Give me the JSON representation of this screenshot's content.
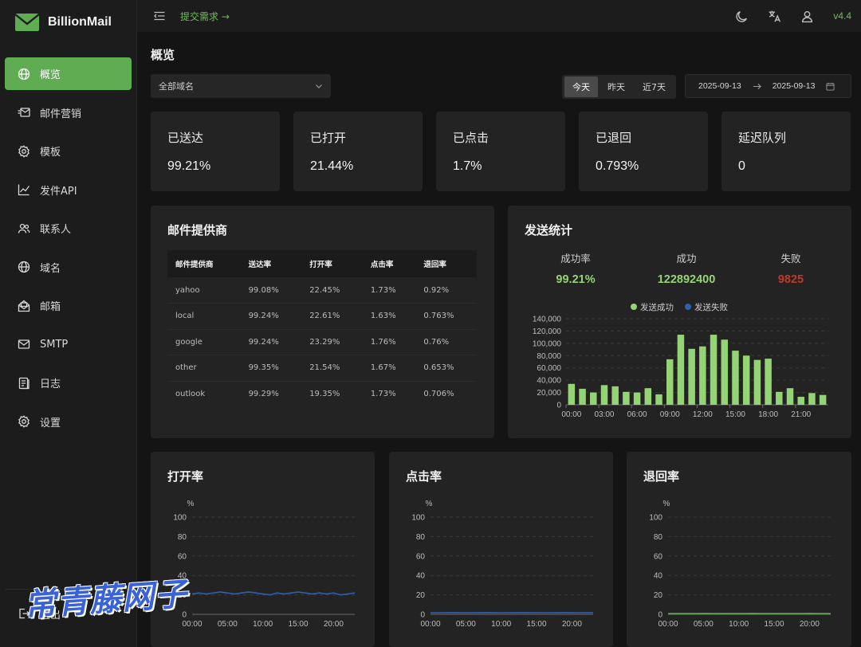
{
  "app": {
    "name": "BillionMail",
    "version": "v4.4"
  },
  "topbar": {
    "submit_link": "提交需求 →"
  },
  "sidebar": {
    "items": [
      {
        "label": "概览",
        "icon": "globe-icon",
        "active": true
      },
      {
        "label": "邮件营销",
        "icon": "mail-marketing-icon",
        "active": false
      },
      {
        "label": "模板",
        "icon": "gear-icon",
        "active": false
      },
      {
        "label": "发件API",
        "icon": "chart-line-icon",
        "active": false
      },
      {
        "label": "联系人",
        "icon": "contacts-icon",
        "active": false
      },
      {
        "label": "域名",
        "icon": "globe-icon",
        "active": false
      },
      {
        "label": "邮箱",
        "icon": "mailbox-icon",
        "active": false
      },
      {
        "label": "SMTP",
        "icon": "mail-icon",
        "active": false
      },
      {
        "label": "日志",
        "icon": "log-icon",
        "active": false
      },
      {
        "label": "设置",
        "icon": "gear-icon",
        "active": false
      }
    ],
    "logout_label": "退出"
  },
  "page": {
    "title": "概览"
  },
  "filters": {
    "domain_select": "全部域名",
    "range_tabs": [
      "今天",
      "昨天",
      "近7天"
    ],
    "active_tab": "今天",
    "date_start": "2025-09-13",
    "date_end": "2025-09-13"
  },
  "stats": [
    {
      "label": "已送达",
      "value": "99.21%"
    },
    {
      "label": "已打开",
      "value": "21.44%"
    },
    {
      "label": "已点击",
      "value": "1.7%"
    },
    {
      "label": "已退回",
      "value": "0.793%"
    },
    {
      "label": "延迟队列",
      "value": "0"
    }
  ],
  "providers": {
    "title": "邮件提供商",
    "columns": [
      "邮件提供商",
      "送达率",
      "打开率",
      "点击率",
      "退回率"
    ],
    "rows": [
      [
        "yahoo",
        "99.08%",
        "22.45%",
        "1.73%",
        "0.92%"
      ],
      [
        "local",
        "99.24%",
        "22.61%",
        "1.63%",
        "0.763%"
      ],
      [
        "google",
        "99.24%",
        "23.29%",
        "1.76%",
        "0.76%"
      ],
      [
        "other",
        "99.35%",
        "21.54%",
        "1.67%",
        "0.653%"
      ],
      [
        "outlook",
        "99.29%",
        "19.35%",
        "1.73%",
        "0.706%"
      ]
    ]
  },
  "send_stats": {
    "title": "发送统计",
    "success_rate_label": "成功率",
    "success_rate": "99.21%",
    "success_label": "成功",
    "success": "122892400",
    "fail_label": "失败",
    "fail": "9825"
  },
  "colors": {
    "accent": "#5fac52",
    "success_green": "#95d475",
    "fail_red": "#c0392b",
    "fail_series": "#2f5fb3"
  },
  "chart_data": [
    {
      "type": "bar",
      "legend": [
        "发送成功",
        "发送失败"
      ],
      "legend_position": "top",
      "x": [
        0,
        1,
        2,
        3,
        4,
        5,
        6,
        7,
        8,
        9,
        10,
        11,
        12,
        13,
        14,
        15,
        16,
        17,
        18,
        19,
        20,
        21,
        22,
        23
      ],
      "x_tick_labels": [
        "00:00",
        "03:00",
        "06:00",
        "09:00",
        "12:00",
        "15:00",
        "18:00",
        "21:00"
      ],
      "series": [
        {
          "name": "发送成功",
          "values": [
            34000,
            26000,
            20000,
            32000,
            30000,
            21000,
            20000,
            27000,
            17000,
            74000,
            114000,
            91000,
            95000,
            114000,
            106000,
            88000,
            80000,
            73000,
            75000,
            21000,
            27000,
            13000,
            19000,
            16000
          ]
        },
        {
          "name": "发送失败",
          "values": [
            0,
            0,
            0,
            0,
            0,
            0,
            0,
            0,
            0,
            0,
            0,
            0,
            0,
            0,
            0,
            0,
            0,
            0,
            0,
            0,
            0,
            0,
            0,
            0
          ]
        }
      ],
      "ylim": [
        0,
        140000
      ],
      "y_ticks": [
        "0",
        "20,000",
        "40,000",
        "60,000",
        "80,000",
        "100,000",
        "120,000",
        "140,000"
      ],
      "grid": true
    },
    {
      "type": "line",
      "title": "打开率",
      "ylabel": "%",
      "ylim": [
        0,
        100
      ],
      "y_ticks": [
        "0",
        "20",
        "40",
        "60",
        "80",
        "100"
      ],
      "x_tick_labels": [
        "00:00",
        "05:00",
        "10:00",
        "15:00",
        "20:00"
      ],
      "series": [
        {
          "values": [
            21,
            22,
            21,
            22,
            23,
            22,
            21,
            22,
            23,
            22,
            21,
            20,
            22,
            21,
            22,
            23,
            22,
            21,
            22,
            21,
            22,
            20,
            21,
            22
          ]
        }
      ],
      "grid": true
    },
    {
      "type": "line",
      "title": "点击率",
      "ylabel": "%",
      "ylim": [
        0,
        100
      ],
      "y_ticks": [
        "0",
        "20",
        "40",
        "60",
        "80",
        "100"
      ],
      "x_tick_labels": [
        "00:00",
        "05:00",
        "10:00",
        "15:00",
        "20:00"
      ],
      "series": [
        {
          "values": [
            1.7,
            1.6,
            1.7,
            1.8,
            1.7,
            1.6,
            1.7,
            1.7,
            1.8,
            1.7,
            1.6,
            1.7,
            1.7,
            1.8,
            1.7,
            1.7,
            1.6,
            1.7,
            1.7,
            1.8,
            1.7,
            1.6,
            1.7,
            1.7
          ]
        }
      ],
      "grid": true
    },
    {
      "type": "line",
      "title": "退回率",
      "ylabel": "%",
      "ylim": [
        0,
        100
      ],
      "y_ticks": [
        "0",
        "20",
        "40",
        "60",
        "80",
        "100"
      ],
      "x_tick_labels": [
        "00:00",
        "05:00",
        "10:00",
        "15:00",
        "20:00"
      ],
      "series": [
        {
          "values": [
            0.8,
            0.8,
            0.7,
            0.8,
            0.8,
            0.9,
            0.8,
            0.8,
            0.7,
            0.8,
            0.8,
            0.8,
            0.9,
            0.8,
            0.8,
            0.7,
            0.8,
            0.8,
            0.8,
            0.8,
            0.9,
            0.8,
            0.8,
            0.8
          ]
        }
      ],
      "grid": true
    }
  ],
  "watermark": "常青藤网子"
}
